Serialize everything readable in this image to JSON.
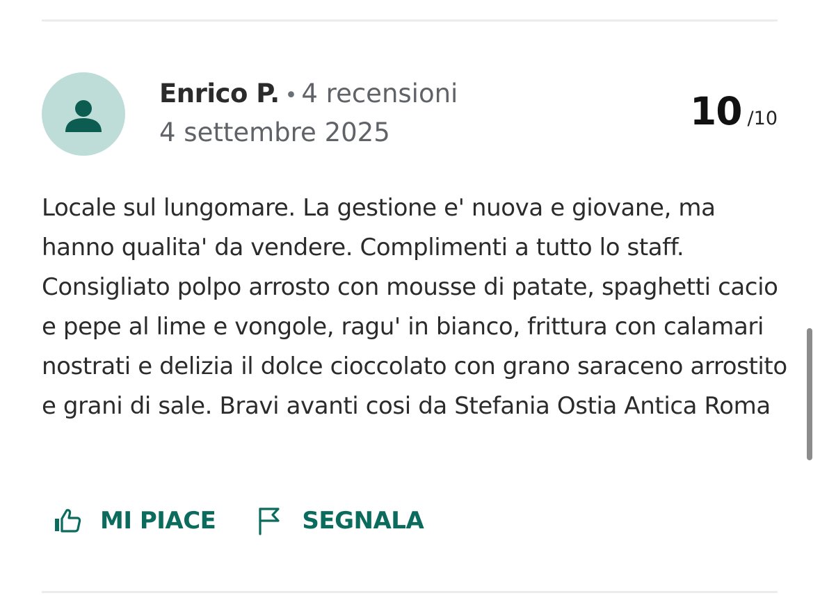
{
  "review": {
    "author": "Enrico P.",
    "separator": "•",
    "review_count": "4 recensioni",
    "date": "4 settembre 2025",
    "score": "10",
    "score_max": "/10",
    "text": "Locale sul lungomare. La gestione e' nuova e giovane, ma hanno qualita' da vendere. Complimenti a tutto lo staff. Consigliato polpo arrosto con mousse di patate, spaghetti cacio e pepe al lime e vongole, ragu' in bianco, frittura con calamari nostrati e delizia il dolce cioccolato con grano saraceno arrostito e grani di sale. Bravi avanti cosi da Stefania Ostia Antica Roma"
  },
  "actions": {
    "like_label": "MI PIACE",
    "report_label": "SEGNALA"
  },
  "icons": {
    "avatar": "user-icon",
    "like": "thumbs-up-icon",
    "report": "flag-icon"
  },
  "colors": {
    "accent": "#0b6b5d",
    "avatar_bg": "#bfddd8",
    "avatar_fg": "#0d5c52",
    "muted_text": "#5f6368"
  }
}
